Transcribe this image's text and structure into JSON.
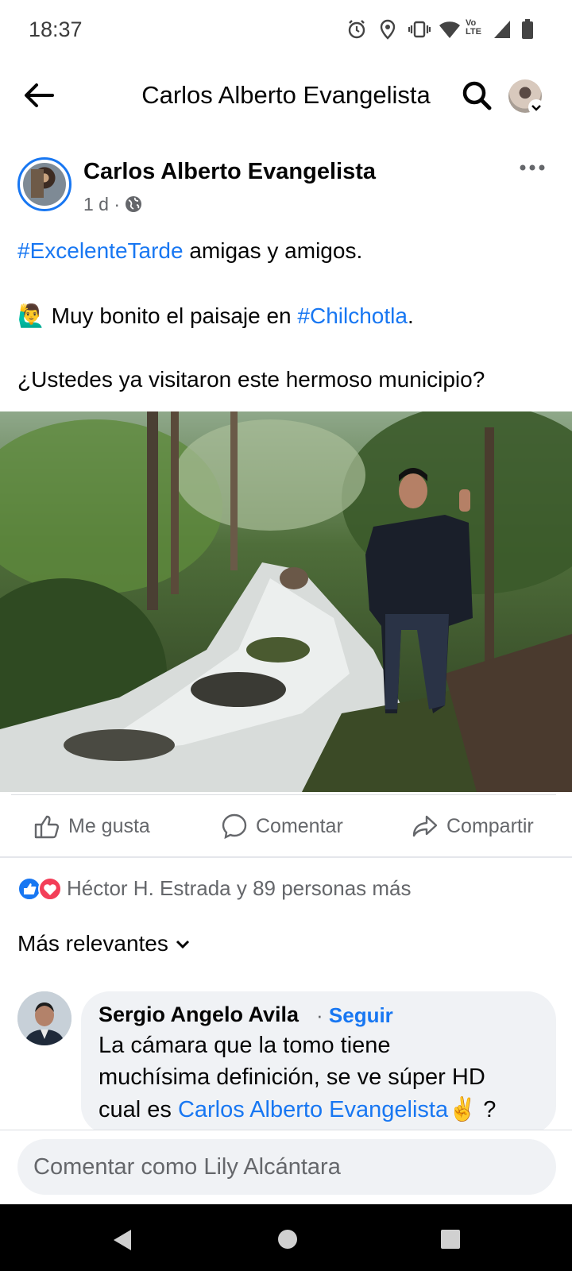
{
  "status_bar": {
    "time": "18:37",
    "icons": [
      "alarm-icon",
      "location-icon",
      "vibrate-icon",
      "wifi-icon",
      "volte-icon",
      "signal-icon",
      "battery-icon"
    ],
    "volte_text": "Vo  LTE"
  },
  "app_bar": {
    "title": "Carlos Alberto Evangelista",
    "back_icon": "arrow-left-icon",
    "search_icon": "search-icon"
  },
  "post": {
    "author": "Carlos Alberto Evangelista",
    "time": "1 d",
    "separator": " · ",
    "privacy_icon": "globe-icon",
    "line1": {
      "hashtag": "#ExcelenteTarde",
      "text": " amigas y amigos."
    },
    "line2": {
      "emoji": "🙋‍♂️",
      "text_before": " Muy bonito el paisaje en ",
      "hashtag": "#Chilchotla",
      "text_after": "."
    },
    "line3": "¿Ustedes ya visitaron este hermoso municipio?"
  },
  "actions": {
    "like": "Me gusta",
    "comment": "Comentar",
    "share": "Compartir"
  },
  "reactions": {
    "summary": "Héctor H. Estrada y 89 personas más",
    "types": [
      "like",
      "love"
    ]
  },
  "comments": {
    "sort_label": "Más relevantes",
    "items": [
      {
        "name": "Sergio Angelo Avila",
        "separator": " · ",
        "follow": "Seguir",
        "line1": "La cámara que la tomo tiene",
        "line2": "muchísima definición, se ve súper HD",
        "line3_before": "cual es ",
        "line3_mention": "Carlos Alberto Evangelista",
        "line3_emoji": "✌️",
        "line3_after": " ?"
      }
    ]
  },
  "composer": {
    "placeholder": "Comentar como Lily Alcántara"
  },
  "colors": {
    "accent": "#1877f2",
    "secondary_text": "#65676b",
    "bubble": "#f0f2f5",
    "love": "#f33e58"
  }
}
